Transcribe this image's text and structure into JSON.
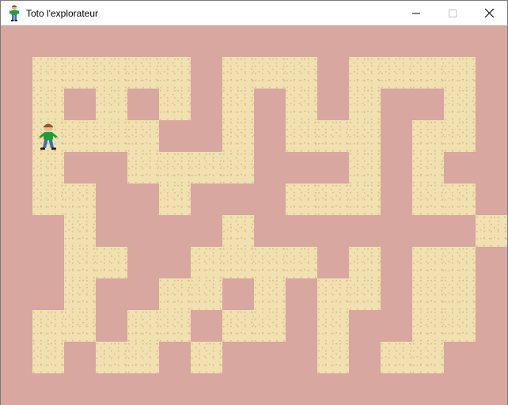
{
  "window": {
    "title": "Toto l'explorateur",
    "app_icon": "explorer-figure-icon",
    "controls": {
      "minimize_icon": "minimize-icon",
      "maximize_icon": "maximize-icon",
      "close_icon": "close-icon"
    }
  },
  "game": {
    "grid_columns": 16,
    "grid_rows": 12,
    "maze": [
      "################",
      "#.....#...#....#",
      "#.#.#.#.#.#.##.#",
      "#P...##.#...#..#",
      "#.##....###.#.##",
      "#..##.###...#..#",
      "##.####.#######.",
      "##..##....#.#..#",
      "##.##..#.#..#..#",
      "#..#..#..#.##..#",
      "#.#..#.###.#..##",
      "################"
    ],
    "legend": {
      "wall": "#",
      "floor": ".",
      "player": "P"
    },
    "player": {
      "name": "Toto",
      "icon": "explorer-character-icon",
      "row": 3,
      "col": 1
    },
    "colors": {
      "brick": "#9e2a2e",
      "mortar": "#d7a7a0",
      "sand": "#f1e1b0",
      "player_shirt": "#1e9e3a",
      "player_pants": "#3c6fb4",
      "player_hair": "#8a5a2b"
    }
  }
}
